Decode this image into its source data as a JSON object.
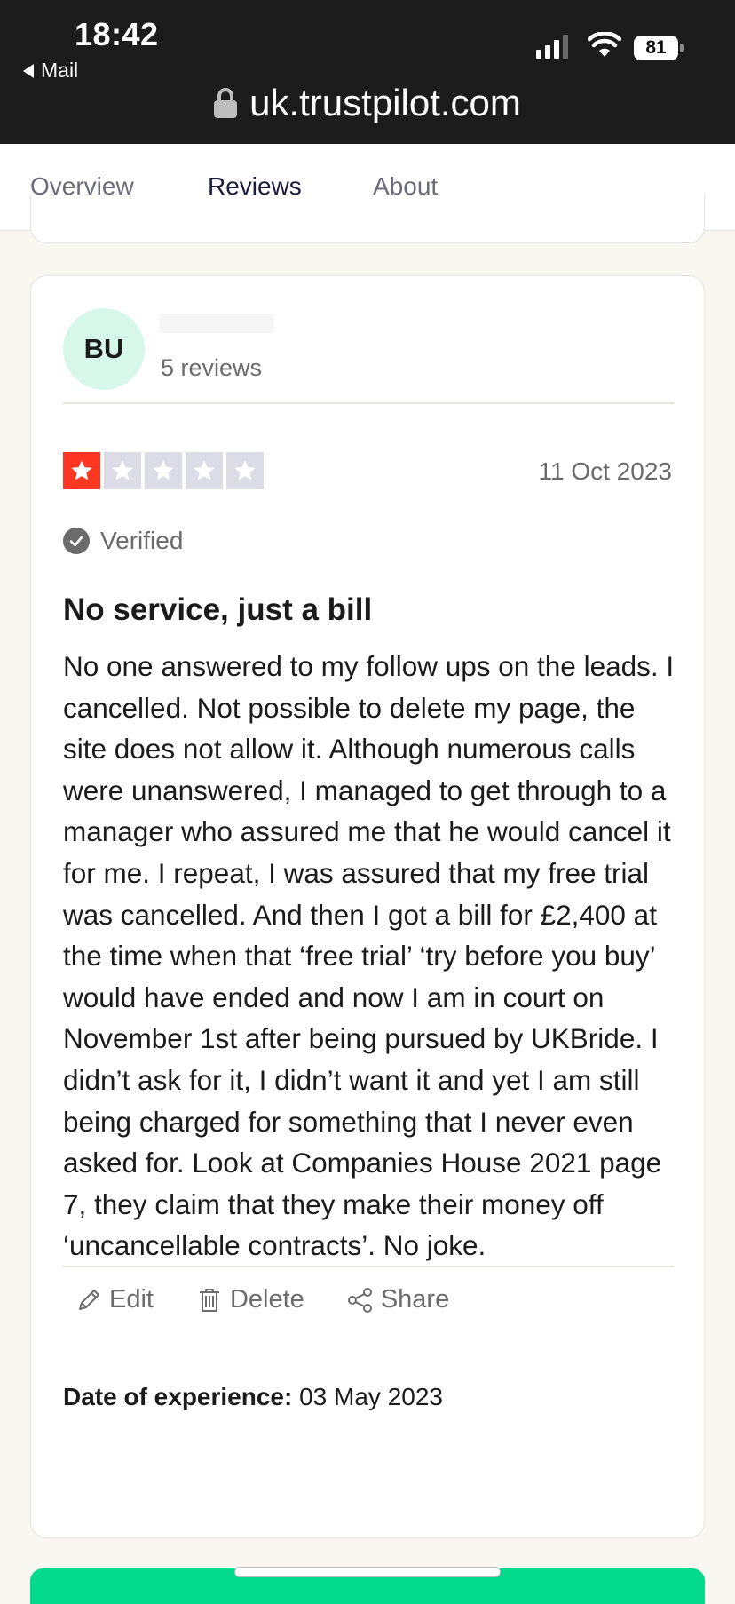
{
  "status_bar": {
    "time": "18:42",
    "back_app": "Mail",
    "battery": "81"
  },
  "browser": {
    "url": "uk.trustpilot.com"
  },
  "tabs": [
    {
      "label": "Overview",
      "active": false
    },
    {
      "label": "Reviews",
      "active": true
    },
    {
      "label": "About",
      "active": false
    }
  ],
  "review": {
    "avatar_initials": "BU",
    "review_count": "5 reviews",
    "rating": 1,
    "rating_max": 5,
    "date": "11 Oct 2023",
    "verified_label": "Verified",
    "title": "No service, just a bill",
    "body": "No one answered to my follow ups on the leads. I cancelled. Not possible to delete my page, the site does not allow it. Although numerous calls were unanswered, I managed to get through to a manager who assured me that he would cancel it for me. I repeat, I was assured that my free trial was cancelled. And then I got a bill for £2,400 at the time when that ‘free trial’ ‘try before you buy’ would have ended and now I am in court on November 1st after being pursued by UKBride. I didn’t ask for it, I didn’t want it and yet I am still being charged for something that I never even asked for. Look at Companies House 2021 page 7, they claim that they make their money off ‘uncancellable contracts’. No joke.",
    "experience_label": "Date of experience:",
    "experience_date": "03 May 2023",
    "actions": {
      "edit": "Edit",
      "delete": "Delete",
      "share": "Share"
    }
  },
  "colors": {
    "star_on": "#ff3722",
    "star_off": "#dcdce6",
    "avatar_bg": "#d7f7ea",
    "brand_green": "#04da8d"
  }
}
